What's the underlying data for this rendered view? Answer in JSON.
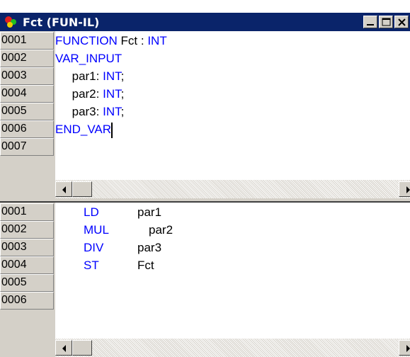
{
  "window": {
    "title": "Fct (FUN-IL)"
  },
  "declaration": {
    "line_numbers": [
      "0001",
      "0002",
      "0003",
      "0004",
      "0005",
      "0006",
      "0007"
    ],
    "lines": [
      {
        "parts": [
          {
            "text": "FUNCTION",
            "kind": "kw"
          },
          {
            "text": " Fct : ",
            "kind": "tx"
          },
          {
            "text": "INT",
            "kind": "kw"
          }
        ]
      },
      {
        "parts": [
          {
            "text": "VAR_INPUT",
            "kind": "kw"
          }
        ]
      },
      {
        "parts": [
          {
            "text": "     par1: ",
            "kind": "tx"
          },
          {
            "text": "INT",
            "kind": "kw"
          },
          {
            "text": ";",
            "kind": "tx"
          }
        ]
      },
      {
        "parts": [
          {
            "text": "     par2: ",
            "kind": "tx"
          },
          {
            "text": "INT",
            "kind": "kw"
          },
          {
            "text": ";",
            "kind": "tx"
          }
        ]
      },
      {
        "parts": [
          {
            "text": "     par3: ",
            "kind": "tx"
          },
          {
            "text": "INT",
            "kind": "kw"
          },
          {
            "text": ";",
            "kind": "tx"
          }
        ]
      },
      {
        "parts": [
          {
            "text": "END_VAR",
            "kind": "kw"
          }
        ]
      },
      {
        "parts": []
      }
    ]
  },
  "instructions": {
    "line_numbers": [
      "0001",
      "0002",
      "0003",
      "0004",
      "0005",
      "0006"
    ],
    "lines": [
      {
        "op": "LD",
        "operand": "par1"
      },
      {
        "op": "MUL",
        "operand": "par2"
      },
      {
        "op": "DIV",
        "operand": "par3"
      },
      {
        "op": "ST",
        "operand": "Fct"
      },
      {
        "op": "",
        "operand": ""
      },
      {
        "op": "",
        "operand": ""
      }
    ]
  },
  "colors": {
    "keyword": "#0000ff",
    "title_bar": "#0a246a",
    "chrome": "#d4d0c8"
  },
  "icons": [
    "colored-balls-app-icon",
    "minimize-icon",
    "maximize-icon",
    "close-icon",
    "arrow-left-icon",
    "arrow-right-icon"
  ]
}
